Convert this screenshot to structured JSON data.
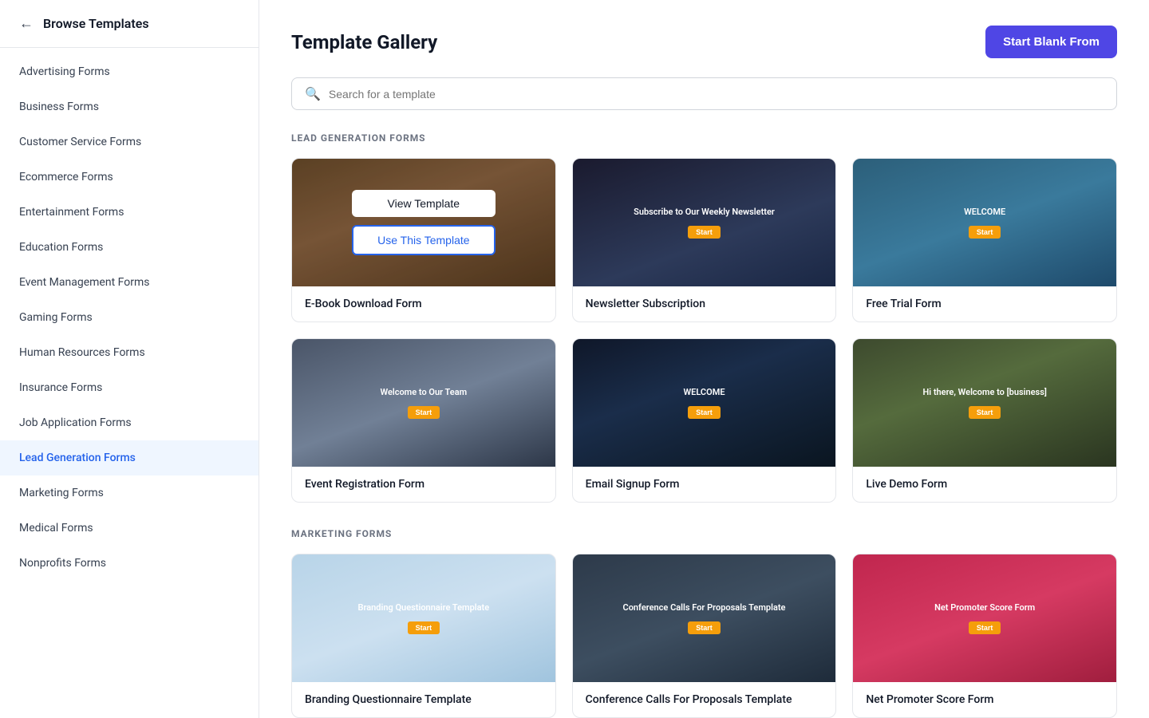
{
  "sidebar": {
    "title": "Browse Templates",
    "items": [
      {
        "id": "advertising",
        "label": "Advertising Forms",
        "active": false
      },
      {
        "id": "business",
        "label": "Business Forms",
        "active": false
      },
      {
        "id": "customer-service",
        "label": "Customer Service Forms",
        "active": false
      },
      {
        "id": "ecommerce",
        "label": "Ecommerce Forms",
        "active": false
      },
      {
        "id": "entertainment",
        "label": "Entertainment Forms",
        "active": false
      },
      {
        "id": "education",
        "label": "Education Forms",
        "active": false
      },
      {
        "id": "event-management",
        "label": "Event Management Forms",
        "active": false
      },
      {
        "id": "gaming",
        "label": "Gaming Forms",
        "active": false
      },
      {
        "id": "human-resources",
        "label": "Human Resources Forms",
        "active": false
      },
      {
        "id": "insurance",
        "label": "Insurance Forms",
        "active": false
      },
      {
        "id": "job-application",
        "label": "Job Application Forms",
        "active": false
      },
      {
        "id": "lead-generation",
        "label": "Lead Generation Forms",
        "active": true
      },
      {
        "id": "marketing",
        "label": "Marketing Forms",
        "active": false
      },
      {
        "id": "medical",
        "label": "Medical Forms",
        "active": false
      },
      {
        "id": "nonprofits",
        "label": "Nonprofits Forms",
        "active": false
      }
    ]
  },
  "header": {
    "title": "Template Gallery",
    "start_blank_label": "Start Blank From"
  },
  "search": {
    "placeholder": "Search for a template"
  },
  "sections": {
    "lead_generation": {
      "title": "LEAD GENERATION FORMS",
      "cards": [
        {
          "id": "ebook",
          "label": "E-Book Download Form",
          "bg": "bg-wood",
          "mini_title": "",
          "show_hover": true
        },
        {
          "id": "newsletter",
          "label": "Newsletter Subscription",
          "bg": "bg-dark-blue",
          "mini_title": "Subscribe to Our Weekly Newsletter",
          "show_hover": false
        },
        {
          "id": "free-trial",
          "label": "Free Trial Form",
          "bg": "bg-teal-blue",
          "mini_title": "WELCOME",
          "show_hover": false
        },
        {
          "id": "event-reg",
          "label": "Event Registration Form",
          "bg": "bg-office",
          "mini_title": "Welcome to Our Team",
          "show_hover": false
        },
        {
          "id": "email-signup",
          "label": "Email Signup Form",
          "bg": "bg-night-sky",
          "mini_title": "WELCOME",
          "show_hover": false
        },
        {
          "id": "live-demo",
          "label": "Live Demo Form",
          "bg": "bg-mountain",
          "mini_title": "Hi there, Welcome to [business]",
          "show_hover": false
        }
      ]
    },
    "marketing": {
      "title": "MARKETING FORMS",
      "cards": [
        {
          "id": "branding",
          "label": "Branding Questionnaire Template",
          "bg": "bg-light-blue",
          "mini_title": "Branding Questionnaire Template",
          "show_hover": false
        },
        {
          "id": "conference",
          "label": "Conference Calls For Proposals Template",
          "bg": "bg-conference",
          "mini_title": "Conference Calls For Proposals Template",
          "show_hover": false
        },
        {
          "id": "nps",
          "label": "Net Promoter Score Form",
          "bg": "bg-pink",
          "mini_title": "Net Promoter Score Form",
          "show_hover": false
        }
      ]
    }
  },
  "buttons": {
    "view_template": "View Template",
    "use_template": "Use This Template"
  }
}
